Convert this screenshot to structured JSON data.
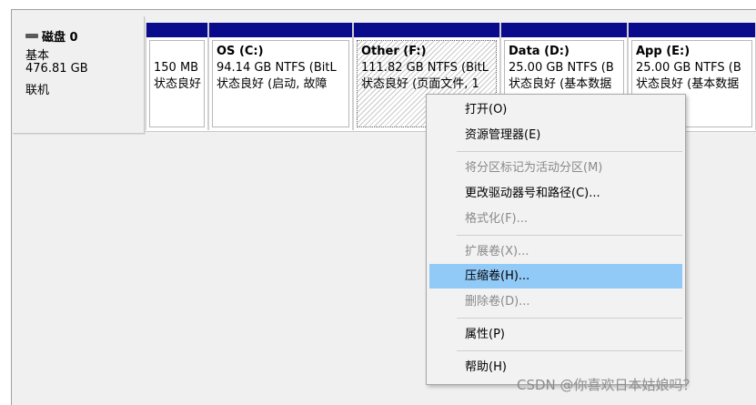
{
  "disk": {
    "title": "磁盘 0",
    "type": "基本",
    "size": "476.81 GB",
    "status": "联机"
  },
  "partitions": [
    {
      "name": "",
      "line1": "150 MB",
      "line2": "状态良好"
    },
    {
      "name": "OS  (C:)",
      "line1": "94.14 GB NTFS (BitL",
      "line2": "状态良好 (启动, 故障"
    },
    {
      "name": "Other  (F:)",
      "line1": "111.82 GB NTFS (BitL",
      "line2": "状态良好 (页面文件, 1"
    },
    {
      "name": "Data  (D:)",
      "line1": "25.00 GB NTFS (B",
      "line2": "状态良好 (基本数据"
    },
    {
      "name": "App  (E:)",
      "line1": "25.00 GB NTFS (B",
      "line2": "状态良好 (基本数据"
    }
  ],
  "context_menu": {
    "open": "打开(O)",
    "explorer": "资源管理器(E)",
    "mark_active": "将分区标记为活动分区(M)",
    "change_letter": "更改驱动器号和路径(C)...",
    "format": "格式化(F)...",
    "extend": "扩展卷(X)...",
    "shrink": "压缩卷(H)...",
    "delete": "删除卷(D)...",
    "properties": "属性(P)",
    "help": "帮助(H)"
  },
  "watermark": "CSDN @你喜欢日本姑娘吗？",
  "colors": {
    "partition_header": "#0a0a8c",
    "menu_highlight": "#91c9f7"
  }
}
